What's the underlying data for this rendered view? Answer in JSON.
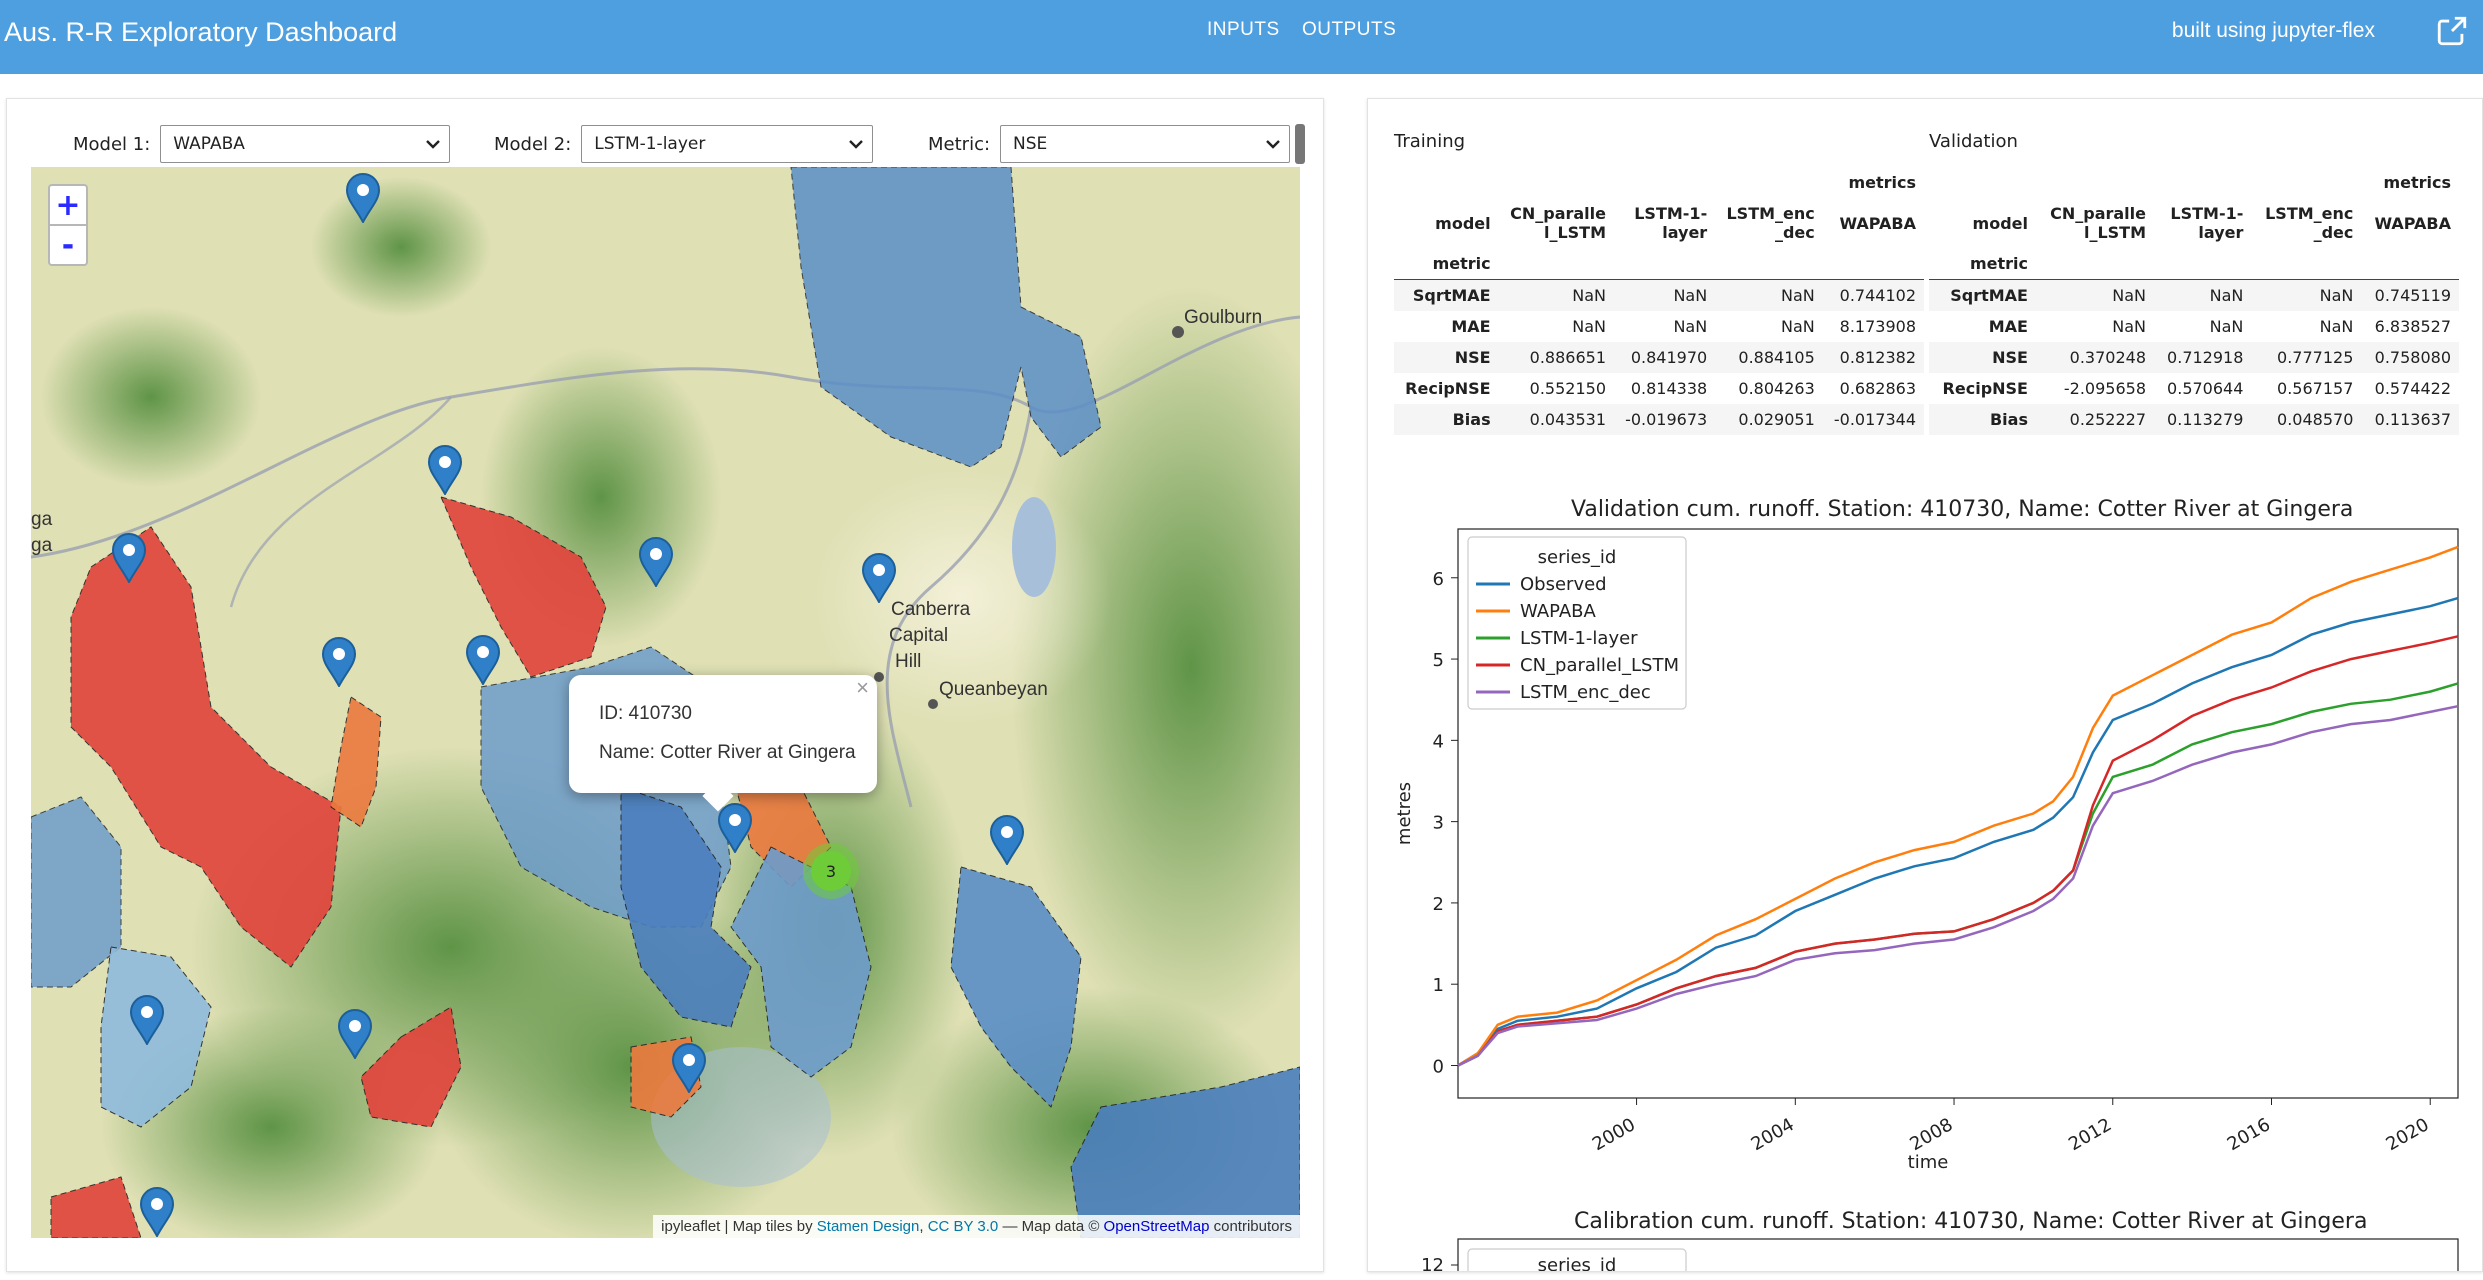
{
  "header": {
    "title": "Aus. R-R Exploratory Dashboard",
    "nav_inputs": "INPUTS",
    "nav_outputs": "OUTPUTS",
    "built_with": "built using jupyter-flex",
    "brand_color": "#4e9fe0"
  },
  "controls": {
    "model1_label": "Model 1:",
    "model1_value": "WAPABA",
    "model2_label": "Model 2:",
    "model2_value": "LSTM-1-layer",
    "metric_label": "Metric:",
    "metric_value": "NSE"
  },
  "map": {
    "zoom_in": "+",
    "zoom_out": "-",
    "popup_close": "×",
    "popup_id": "ID: 410730",
    "popup_name": "Name: Cotter River at Gingera",
    "cluster_count": "3",
    "places": [
      "Goulburn",
      "Canberra",
      "Capital",
      "Hill",
      "Queanbeyan",
      "ga",
      "ga"
    ],
    "attribution_prefix": "ipyleaflet | Map tiles by ",
    "attribution_stamen": "Stamen Design",
    "attribution_sep": ", ",
    "attribution_cc": "CC BY 3.0",
    "attribution_mid": " — Map data © ",
    "attribution_osm": "OpenStreetMap",
    "attribution_suffix": " contributors"
  },
  "tables": {
    "training_label": "Training",
    "validation_label": "Validation",
    "metrics_header": "metrics",
    "model_header": "model",
    "metric_header": "metric",
    "columns": [
      "CN_paralle l_LSTM",
      "LSTM-1- layer",
      "LSTM_enc _dec",
      "WAPABA"
    ],
    "training_rows": [
      {
        "metric": "SqrtMAE",
        "values": [
          "NaN",
          "NaN",
          "NaN",
          "0.744102"
        ]
      },
      {
        "metric": "MAE",
        "values": [
          "NaN",
          "NaN",
          "NaN",
          "8.173908"
        ]
      },
      {
        "metric": "NSE",
        "values": [
          "0.886651",
          "0.841970",
          "0.884105",
          "0.812382"
        ]
      },
      {
        "metric": "RecipNSE",
        "values": [
          "0.552150",
          "0.814338",
          "0.804263",
          "0.682863"
        ]
      },
      {
        "metric": "Bias",
        "values": [
          "0.043531",
          "-0.019673",
          "0.029051",
          "-0.017344"
        ]
      }
    ],
    "validation_rows": [
      {
        "metric": "SqrtMAE",
        "values": [
          "NaN",
          "NaN",
          "NaN",
          "0.745119"
        ]
      },
      {
        "metric": "MAE",
        "values": [
          "NaN",
          "NaN",
          "NaN",
          "6.838527"
        ]
      },
      {
        "metric": "NSE",
        "values": [
          "0.370248",
          "0.712918",
          "0.777125",
          "0.758080"
        ]
      },
      {
        "metric": "RecipNSE",
        "values": [
          "-2.095658",
          "0.570644",
          "0.567157",
          "0.574422"
        ]
      },
      {
        "metric": "Bias",
        "values": [
          "0.252227",
          "0.113279",
          "0.048570",
          "0.113637"
        ]
      }
    ]
  },
  "chart_data": [
    {
      "type": "line",
      "title": "Validation cum. runoff. Station: 410730, Name: Cotter River at Gingera",
      "xlabel": "time",
      "ylabel": "metres",
      "xlim": [
        1995.5,
        2020.7
      ],
      "ylim": [
        -0.4,
        6.6
      ],
      "xticks": [
        2000,
        2004,
        2008,
        2012,
        2016,
        2020
      ],
      "yticks": [
        0,
        1,
        2,
        3,
        4,
        5,
        6
      ],
      "legend_title": "series_id",
      "legend_position": "top-left",
      "x": [
        1995.5,
        1996,
        1996.5,
        1997,
        1998,
        1999,
        2000,
        2001,
        2002,
        2003,
        2004,
        2005,
        2006,
        2007,
        2008,
        2009,
        2010,
        2010.5,
        2011,
        2011.5,
        2012,
        2013,
        2014,
        2015,
        2016,
        2017,
        2018,
        2019,
        2020,
        2020.7
      ],
      "series": [
        {
          "name": "Observed",
          "color": "#1f77b4",
          "values": [
            0.0,
            0.15,
            0.45,
            0.55,
            0.6,
            0.7,
            0.95,
            1.15,
            1.45,
            1.6,
            1.9,
            2.1,
            2.3,
            2.45,
            2.55,
            2.75,
            2.9,
            3.05,
            3.3,
            3.85,
            4.25,
            4.45,
            4.7,
            4.9,
            5.05,
            5.3,
            5.45,
            5.55,
            5.65,
            5.75
          ]
        },
        {
          "name": "WAPABA",
          "color": "#ff7f0e",
          "values": [
            0.0,
            0.15,
            0.5,
            0.6,
            0.65,
            0.8,
            1.05,
            1.3,
            1.6,
            1.8,
            2.05,
            2.3,
            2.5,
            2.65,
            2.75,
            2.95,
            3.1,
            3.25,
            3.55,
            4.15,
            4.55,
            4.8,
            5.05,
            5.3,
            5.45,
            5.75,
            5.95,
            6.1,
            6.25,
            6.38
          ]
        },
        {
          "name": "LSTM-1-layer",
          "color": "#2ca02c",
          "values": [
            0.0,
            0.12,
            0.42,
            0.5,
            0.55,
            0.6,
            0.75,
            0.95,
            1.1,
            1.2,
            1.4,
            1.5,
            1.55,
            1.62,
            1.65,
            1.8,
            2.0,
            2.15,
            2.4,
            3.1,
            3.55,
            3.7,
            3.95,
            4.1,
            4.2,
            4.35,
            4.45,
            4.5,
            4.6,
            4.7
          ]
        },
        {
          "name": "CN_parallel_LSTM",
          "color": "#d62728",
          "values": [
            0.0,
            0.12,
            0.42,
            0.5,
            0.55,
            0.6,
            0.75,
            0.95,
            1.1,
            1.2,
            1.4,
            1.5,
            1.55,
            1.62,
            1.65,
            1.8,
            2.0,
            2.15,
            2.4,
            3.2,
            3.75,
            4.0,
            4.3,
            4.5,
            4.65,
            4.85,
            5.0,
            5.1,
            5.2,
            5.28
          ]
        },
        {
          "name": "LSTM_enc_dec",
          "color": "#9467bd",
          "values": [
            0.0,
            0.12,
            0.4,
            0.48,
            0.52,
            0.56,
            0.7,
            0.88,
            1.0,
            1.1,
            1.3,
            1.38,
            1.42,
            1.5,
            1.55,
            1.7,
            1.9,
            2.05,
            2.3,
            2.95,
            3.35,
            3.5,
            3.7,
            3.85,
            3.95,
            4.1,
            4.2,
            4.25,
            4.35,
            4.42
          ]
        }
      ]
    },
    {
      "type": "line",
      "title": "Calibration cum. runoff. Station: 410730, Name: Cotter River at Gingera",
      "yticks": [
        12
      ],
      "legend_title": "series_id",
      "legend_position": "top-left"
    }
  ]
}
